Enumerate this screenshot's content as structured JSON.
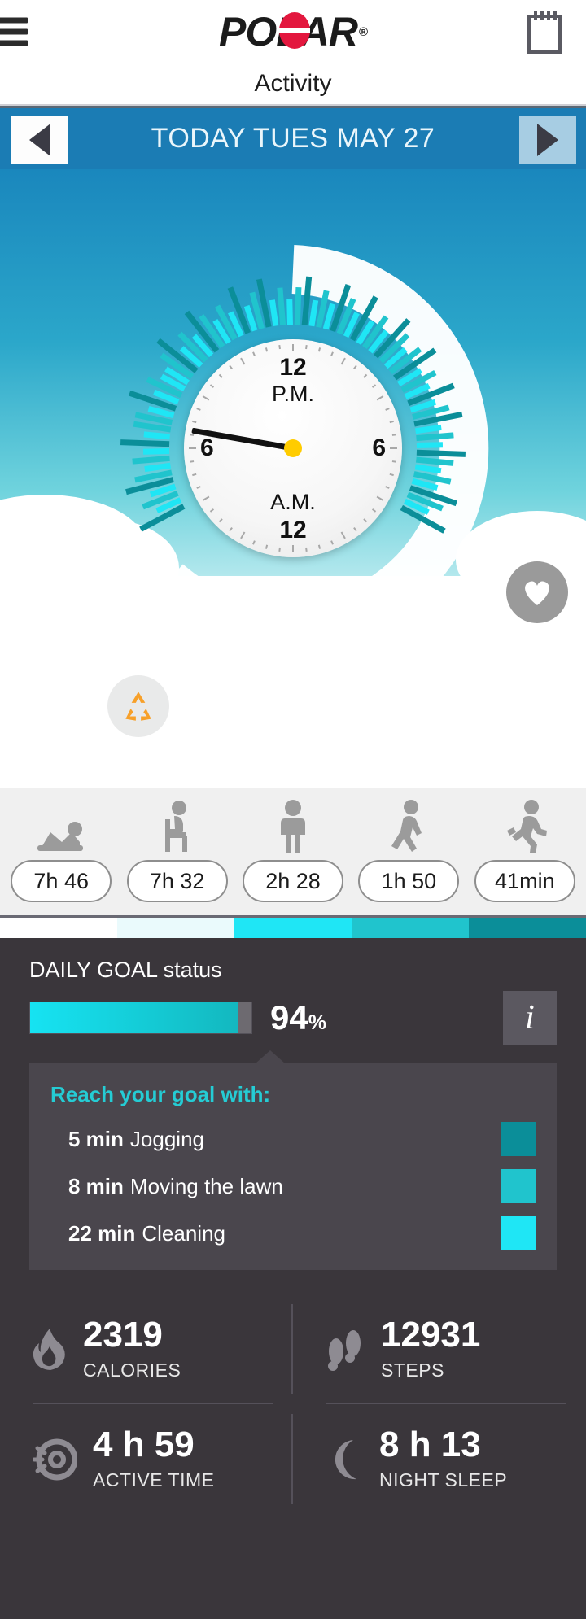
{
  "header": {
    "menu_icon": "hamburger-menu-icon",
    "brand": "POLAR",
    "brand_reg": "®",
    "diary_icon": "notebook-icon"
  },
  "page": {
    "title": "Activity"
  },
  "datebar": {
    "label": "TODAY TUES MAY 27",
    "prev_icon": "previous-day-arrow",
    "next_icon": "next-day-arrow",
    "bg_color": "#1b7cb4"
  },
  "dial": {
    "clock": {
      "top_hour": "12",
      "top_meridiem": "P.M.",
      "bottom_meridiem": "A.M.",
      "bottom_hour": "12",
      "left_hour": "6",
      "right_hour": "6"
    },
    "heart_badge_icon": "heart-icon",
    "recycle_badge_icon": "inactivity-stamp-icon"
  },
  "breakdown": {
    "items": [
      {
        "icon": "lying-down-icon",
        "value": "7h 46"
      },
      {
        "icon": "sitting-icon",
        "value": "7h 32"
      },
      {
        "icon": "standing-icon",
        "value": "2h 28"
      },
      {
        "icon": "walking-icon",
        "value": "1h 50"
      },
      {
        "icon": "running-icon",
        "value": "41min"
      }
    ],
    "colors": [
      "#ffffff",
      "#eafafc",
      "#1fe6f5",
      "#20c4cd",
      "#0b8e99"
    ]
  },
  "goal": {
    "label": "DAILY GOAL status",
    "percent_value": "94",
    "percent_sign": "%",
    "percent_fill": 94,
    "info_icon": "info-icon",
    "info_label": "i"
  },
  "tips": {
    "title": "Reach your goal with:",
    "items": [
      {
        "duration": "5 min",
        "activity": "Jogging",
        "color": "#0b8e99"
      },
      {
        "duration": "8 min",
        "activity": "Moving the lawn",
        "color": "#20c4cd"
      },
      {
        "duration": "22 min",
        "activity": "Cleaning",
        "color": "#1fe6f5"
      }
    ]
  },
  "stats": [
    {
      "icon": "flame-icon",
      "value": "2319",
      "label": "CALORIES"
    },
    {
      "icon": "footsteps-icon",
      "value": "12931",
      "label": "STEPS"
    },
    {
      "icon": "active-time-icon",
      "value": "4 h 59",
      "label": "ACTIVE TIME"
    },
    {
      "icon": "moon-icon",
      "value": "8 h 13",
      "label": "NIGHT SLEEP"
    }
  ]
}
